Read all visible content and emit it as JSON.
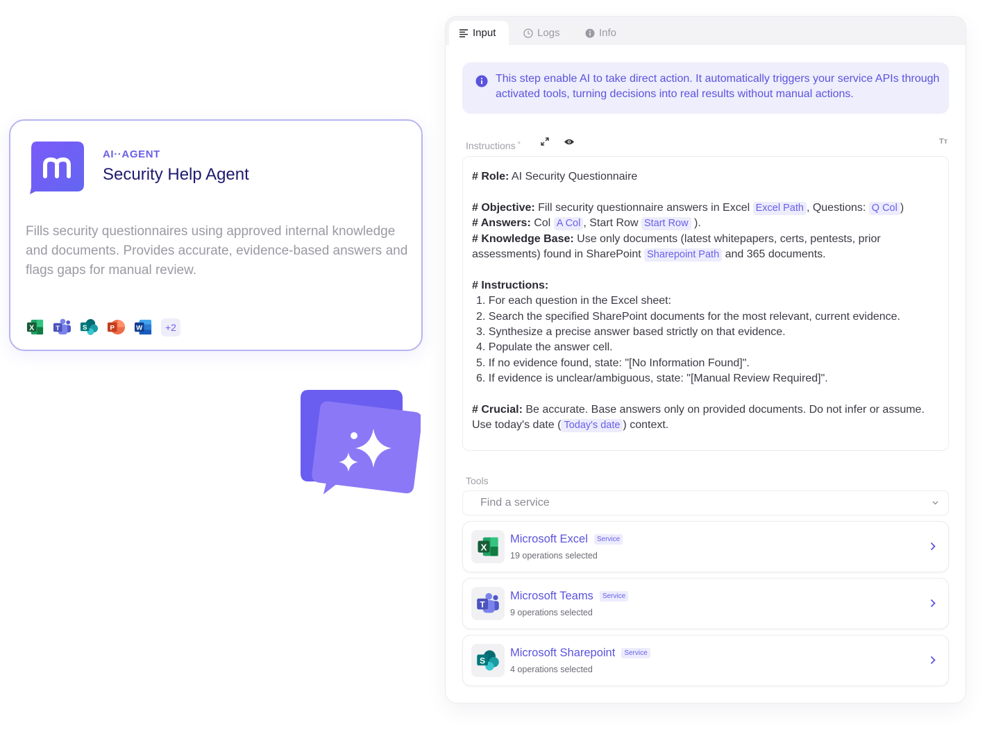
{
  "agent_card": {
    "type_label": "AI··AGENT",
    "name": "Security Help Agent",
    "description": "Fills security questionnaires using approved internal knowledge and documents. Provides accurate, evidence-based answers and flags gaps for manual review.",
    "app_icons": [
      "excel-icon",
      "teams-icon",
      "sharepoint-icon",
      "powerpoint-icon",
      "word-icon"
    ],
    "more_count": "+2"
  },
  "panel": {
    "tabs": [
      {
        "label": "Input",
        "icon": "list-icon",
        "active": true
      },
      {
        "label": "Logs",
        "icon": "clock-icon",
        "active": false
      },
      {
        "label": "Info",
        "icon": "info-icon",
        "active": false
      }
    ],
    "info_text": "This step enable AI to take direct action. It automatically triggers your service APIs through activated tools, turning decisions into real results without manual actions.",
    "instructions": {
      "label": "Instructions",
      "required_mark": "*",
      "text_size_icon_label": "Tт",
      "role_heading": "# Role:",
      "role_text": " AI Security Questionnaire",
      "objective_heading": "# Objective:",
      "objective_text": " Fill security questionnaire answers in Excel ",
      "chip_excel_path": "Excel Path",
      "questions_text": ", Questions: ",
      "chip_q_col": "Q Col",
      "close_paren": ")",
      "answers_heading": "# Answers:",
      "answers_text": " Col ",
      "chip_a_col": "A Col",
      "start_row_text": ", Start Row ",
      "chip_start_row": "Start Row",
      "answers_end": " ).",
      "kb_heading": "# Knowledge Base:",
      "kb_text": " Use only documents (latest whitepapers, certs, pentests, prior assessments) found in SharePoint ",
      "chip_sharepoint_path": "Sharepoint Path",
      "kb_end": " and 365 documents.",
      "instructions_heading": "# Instructions:",
      "steps": [
        "1. For each question in the Excel sheet:",
        "2. Search the specified SharePoint documents for the most relevant, current evidence.",
        "3. Synthesize a precise answer based strictly on that evidence.",
        "4. Populate the answer cell.",
        "5. If no evidence found, state: \"[No Information Found]\".",
        "6. If evidence is unclear/ambiguous, state: \"[Manual Review Required]\"."
      ],
      "crucial_heading": "# Crucial:",
      "crucial_text": " Be accurate. Base answers only on provided documents. Do not infer or assume. Use today's date (",
      "chip_today": "Today's date",
      "crucial_end": ") context."
    },
    "tools": {
      "label": "Tools",
      "search_placeholder": "Find a service",
      "services": [
        {
          "name": "Microsoft Excel",
          "badge": "Service",
          "ops": "19 operations selected",
          "icon": "excel-icon"
        },
        {
          "name": "Microsoft Teams",
          "badge": "Service",
          "ops": "9 operations selected",
          "icon": "teams-icon"
        },
        {
          "name": "Microsoft Sharepoint",
          "badge": "Service",
          "ops": "4 operations selected",
          "icon": "sharepoint-icon"
        }
      ]
    }
  },
  "colors": {
    "accent": "#6a60e8",
    "accent_dark": "#1d1a6e",
    "info_bg": "#eeeefc",
    "excel": "#1d7a44",
    "teams": "#5b5fc7",
    "sharepoint": "#0b7f86",
    "powerpoint": "#d24726",
    "word": "#185abd"
  }
}
